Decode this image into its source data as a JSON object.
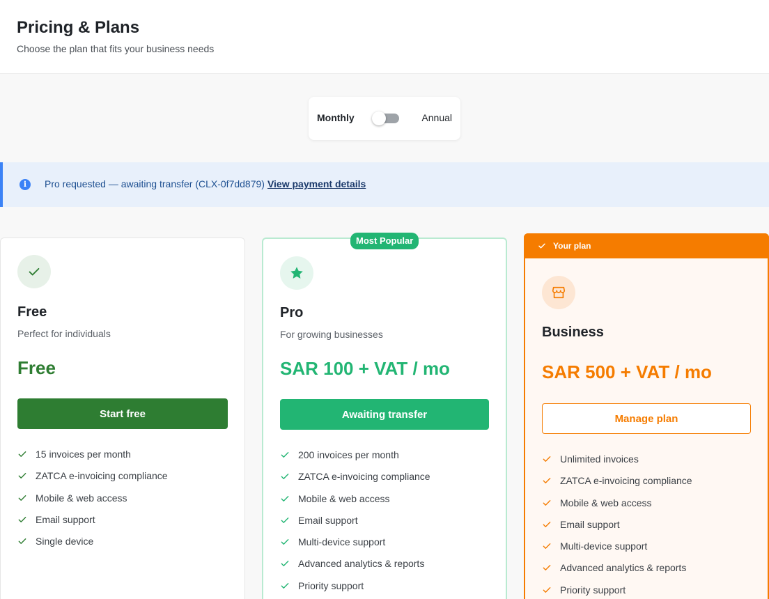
{
  "header": {
    "title": "Pricing & Plans",
    "subtitle": "Choose the plan that fits your business needs"
  },
  "billing_toggle": {
    "monthly_label": "Monthly",
    "annual_label": "Annual",
    "selected": "Monthly"
  },
  "banner": {
    "icon": "info-icon",
    "message": "Pro requested — awaiting transfer (CLX-0f7dd879)",
    "link_label": "View payment details",
    "accent_color": "#3b82f6"
  },
  "plans": [
    {
      "id": "free",
      "icon": "check-icon",
      "name": "Free",
      "description": "Perfect for individuals",
      "price": "Free",
      "button_label": "Start free",
      "accent_color": "#2e7d32",
      "features": [
        "15 invoices per month",
        "ZATCA e-invoicing compliance",
        "Mobile & web access",
        "Email support",
        "Single device"
      ]
    },
    {
      "id": "pro",
      "icon": "star-icon",
      "badge": "Most Popular",
      "name": "Pro",
      "description": "For growing businesses",
      "price": "SAR 100 + VAT / mo",
      "button_label": "Awaiting transfer",
      "accent_color": "#22b573",
      "features": [
        "200 invoices per month",
        "ZATCA e-invoicing compliance",
        "Mobile & web access",
        "Email support",
        "Multi-device support",
        "Advanced analytics & reports",
        "Priority support"
      ]
    },
    {
      "id": "business",
      "icon": "store-icon",
      "current_badge": "Your plan",
      "name": "Business",
      "price": "SAR 500 + VAT / mo",
      "button_label": "Manage plan",
      "accent_color": "#f57c00",
      "features": [
        "Unlimited invoices",
        "ZATCA e-invoicing compliance",
        "Mobile & web access",
        "Email support",
        "Multi-device support",
        "Advanced analytics & reports",
        "Priority support"
      ]
    }
  ]
}
